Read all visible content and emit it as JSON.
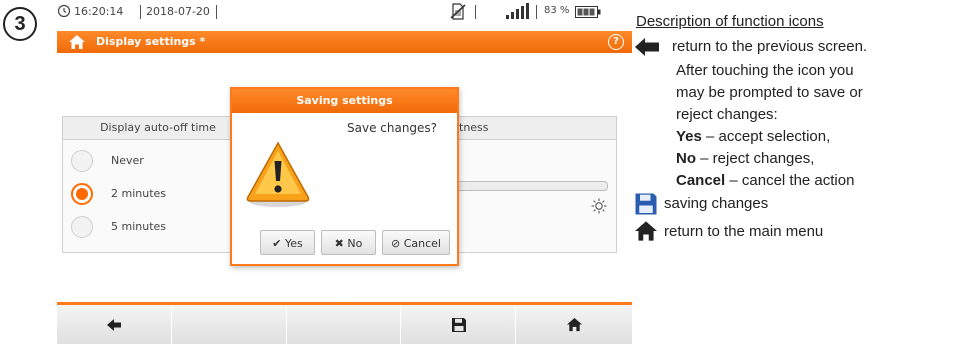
{
  "step_number": "3",
  "status_bar": {
    "time": "16:20:14",
    "date": "2018-07-20",
    "battery_percent": "83 %",
    "icons": [
      "clock-icon",
      "no-sim-icon",
      "signal-icon",
      "battery-icon"
    ]
  },
  "title_bar": {
    "title": "Display settings *",
    "icons": [
      "home-icon",
      "help-icon"
    ]
  },
  "display_auto_off": {
    "header": "Display auto-off time",
    "options": [
      "Never",
      "2 minutes",
      "5 minutes"
    ],
    "selected": "2 minutes"
  },
  "brightness_panel": {
    "header_fragment": "tness",
    "icons": [
      "sun-icon"
    ]
  },
  "dialog": {
    "title": "Saving settings",
    "message": "Save changes?",
    "buttons": {
      "yes": "Yes",
      "no": "No",
      "cancel": "Cancel"
    },
    "icons": [
      "warning-icon",
      "check-icon",
      "x-icon",
      "cancel-icon"
    ]
  },
  "toolbar": {
    "icons": [
      "back-arrow-icon",
      "save-icon",
      "home-icon"
    ]
  },
  "description": {
    "heading": "Description of function icons",
    "back_text": "return to the previous screen.",
    "back_detail_1": "After touching the icon you",
    "back_detail_2": "may be prompted to save or",
    "back_detail_3": "reject changes:",
    "yes_label": "Yes",
    "yes_text": " – accept selection,",
    "no_label": "No",
    "no_text": " – reject changes,",
    "cancel_label": "Cancel",
    "cancel_text": " – cancel the action",
    "save_text": "saving changes",
    "home_text": "return to the main menu"
  },
  "colors": {
    "accent": "#ff7a1a",
    "selected_radio": "#ff6a00"
  }
}
